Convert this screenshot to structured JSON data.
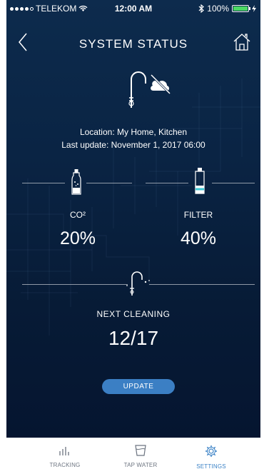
{
  "status_bar": {
    "carrier": "TELEKOM",
    "time": "12:00 AM",
    "battery": "100%"
  },
  "header": {
    "title": "SYSTEM STATUS"
  },
  "device": {
    "location": "Location: My Home, Kitchen",
    "last_update": "Last update: November 1, 2017 06:00"
  },
  "metrics": {
    "co2": {
      "label": "CO²",
      "value": "20%"
    },
    "filter": {
      "label": "FILTER",
      "value": "40%"
    }
  },
  "cleaning": {
    "label": "NEXT CLEANING",
    "value": "12/17"
  },
  "update_button": "UPDATE",
  "tabs": [
    {
      "label": "TRACKING",
      "icon": "bar-chart-icon",
      "active": false
    },
    {
      "label": "TAP WATER",
      "icon": "glass-icon",
      "active": false
    },
    {
      "label": "SETTINGS",
      "icon": "gear-icon",
      "active": true
    }
  ],
  "colors": {
    "background_top": "#0d2b4d",
    "background_bottom": "#051530",
    "accent": "#3b7fc4",
    "battery": "#4cd964",
    "tab_active": "#3b82c6",
    "tab_inactive": "#6c7480"
  }
}
